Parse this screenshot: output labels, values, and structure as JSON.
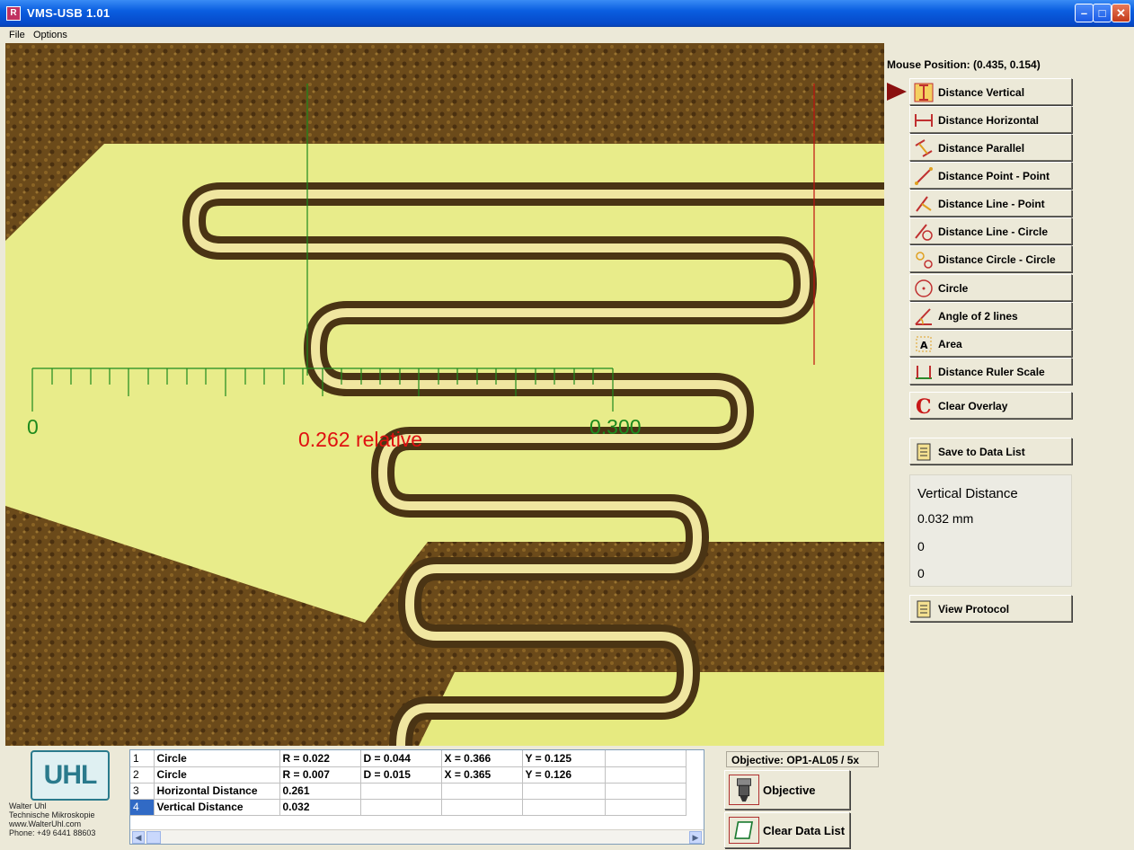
{
  "window": {
    "title": "VMS-USB   1.01",
    "icon": "vms-app-icon"
  },
  "menu": {
    "file": "File",
    "options": "Options"
  },
  "overlay": {
    "ruler_start_label": "0",
    "ruler_end_label": "0.300",
    "measure_label": "0.262 relative"
  },
  "panel": {
    "mouse_position": "Mouse Position: (0.435, 0.154)",
    "tools": [
      {
        "label": "Distance Vertical",
        "icon": "vertical-distance-icon",
        "active": true
      },
      {
        "label": "Distance Horizontal",
        "icon": "horizontal-distance-icon"
      },
      {
        "label": "Distance Parallel",
        "icon": "parallel-distance-icon"
      },
      {
        "label": "Distance Point - Point",
        "icon": "point-point-icon"
      },
      {
        "label": "Distance Line - Point",
        "icon": "line-point-icon"
      },
      {
        "label": "Distance Line - Circle",
        "icon": "line-circle-icon"
      },
      {
        "label": "Distance Circle - Circle",
        "icon": "circle-circle-icon"
      },
      {
        "label": "Circle",
        "icon": "circle-icon"
      },
      {
        "label": "Angle of 2 lines",
        "icon": "angle-icon"
      },
      {
        "label": "Area",
        "icon": "area-icon"
      },
      {
        "label": "Distance Ruler Scale",
        "icon": "ruler-scale-icon"
      },
      {
        "label": "Clear Overlay",
        "icon": "clear-overlay-icon"
      }
    ],
    "save_label": "Save to Data List",
    "result": {
      "title": "Vertical Distance",
      "value": "0.032 mm",
      "line2": "0",
      "line3": "0"
    },
    "view_protocol_label": "View Protocol"
  },
  "logo": {
    "text": "UHL",
    "lines": [
      "Walter Uhl",
      "Technische Mikroskopie",
      "www.WalterUhl.com",
      "Phone: +49 6441 88603"
    ]
  },
  "data_list": {
    "rows": [
      {
        "n": "1",
        "name": "Circle",
        "c1": "R = 0.022",
        "c2": "D = 0.044",
        "c3": "X = 0.366",
        "c4": "Y = 0.125"
      },
      {
        "n": "2",
        "name": "Circle",
        "c1": "R = 0.007",
        "c2": "D = 0.015",
        "c3": "X = 0.365",
        "c4": "Y = 0.126"
      },
      {
        "n": "3",
        "name": "Horizontal Distance",
        "c1": "0.261",
        "c2": "",
        "c3": "",
        "c4": ""
      },
      {
        "n": "4",
        "name": "Vertical Distance",
        "c1": "0.032",
        "c2": "",
        "c3": "",
        "c4": ""
      }
    ]
  },
  "objective": {
    "label": "Objective: OP1-AL05 / 5x",
    "button_label": "Objective",
    "clear_label": "Clear Data List"
  },
  "colors": {
    "ruler": "#1d8a1d",
    "measure": "#e01010",
    "titlebar": "#0548c8"
  }
}
